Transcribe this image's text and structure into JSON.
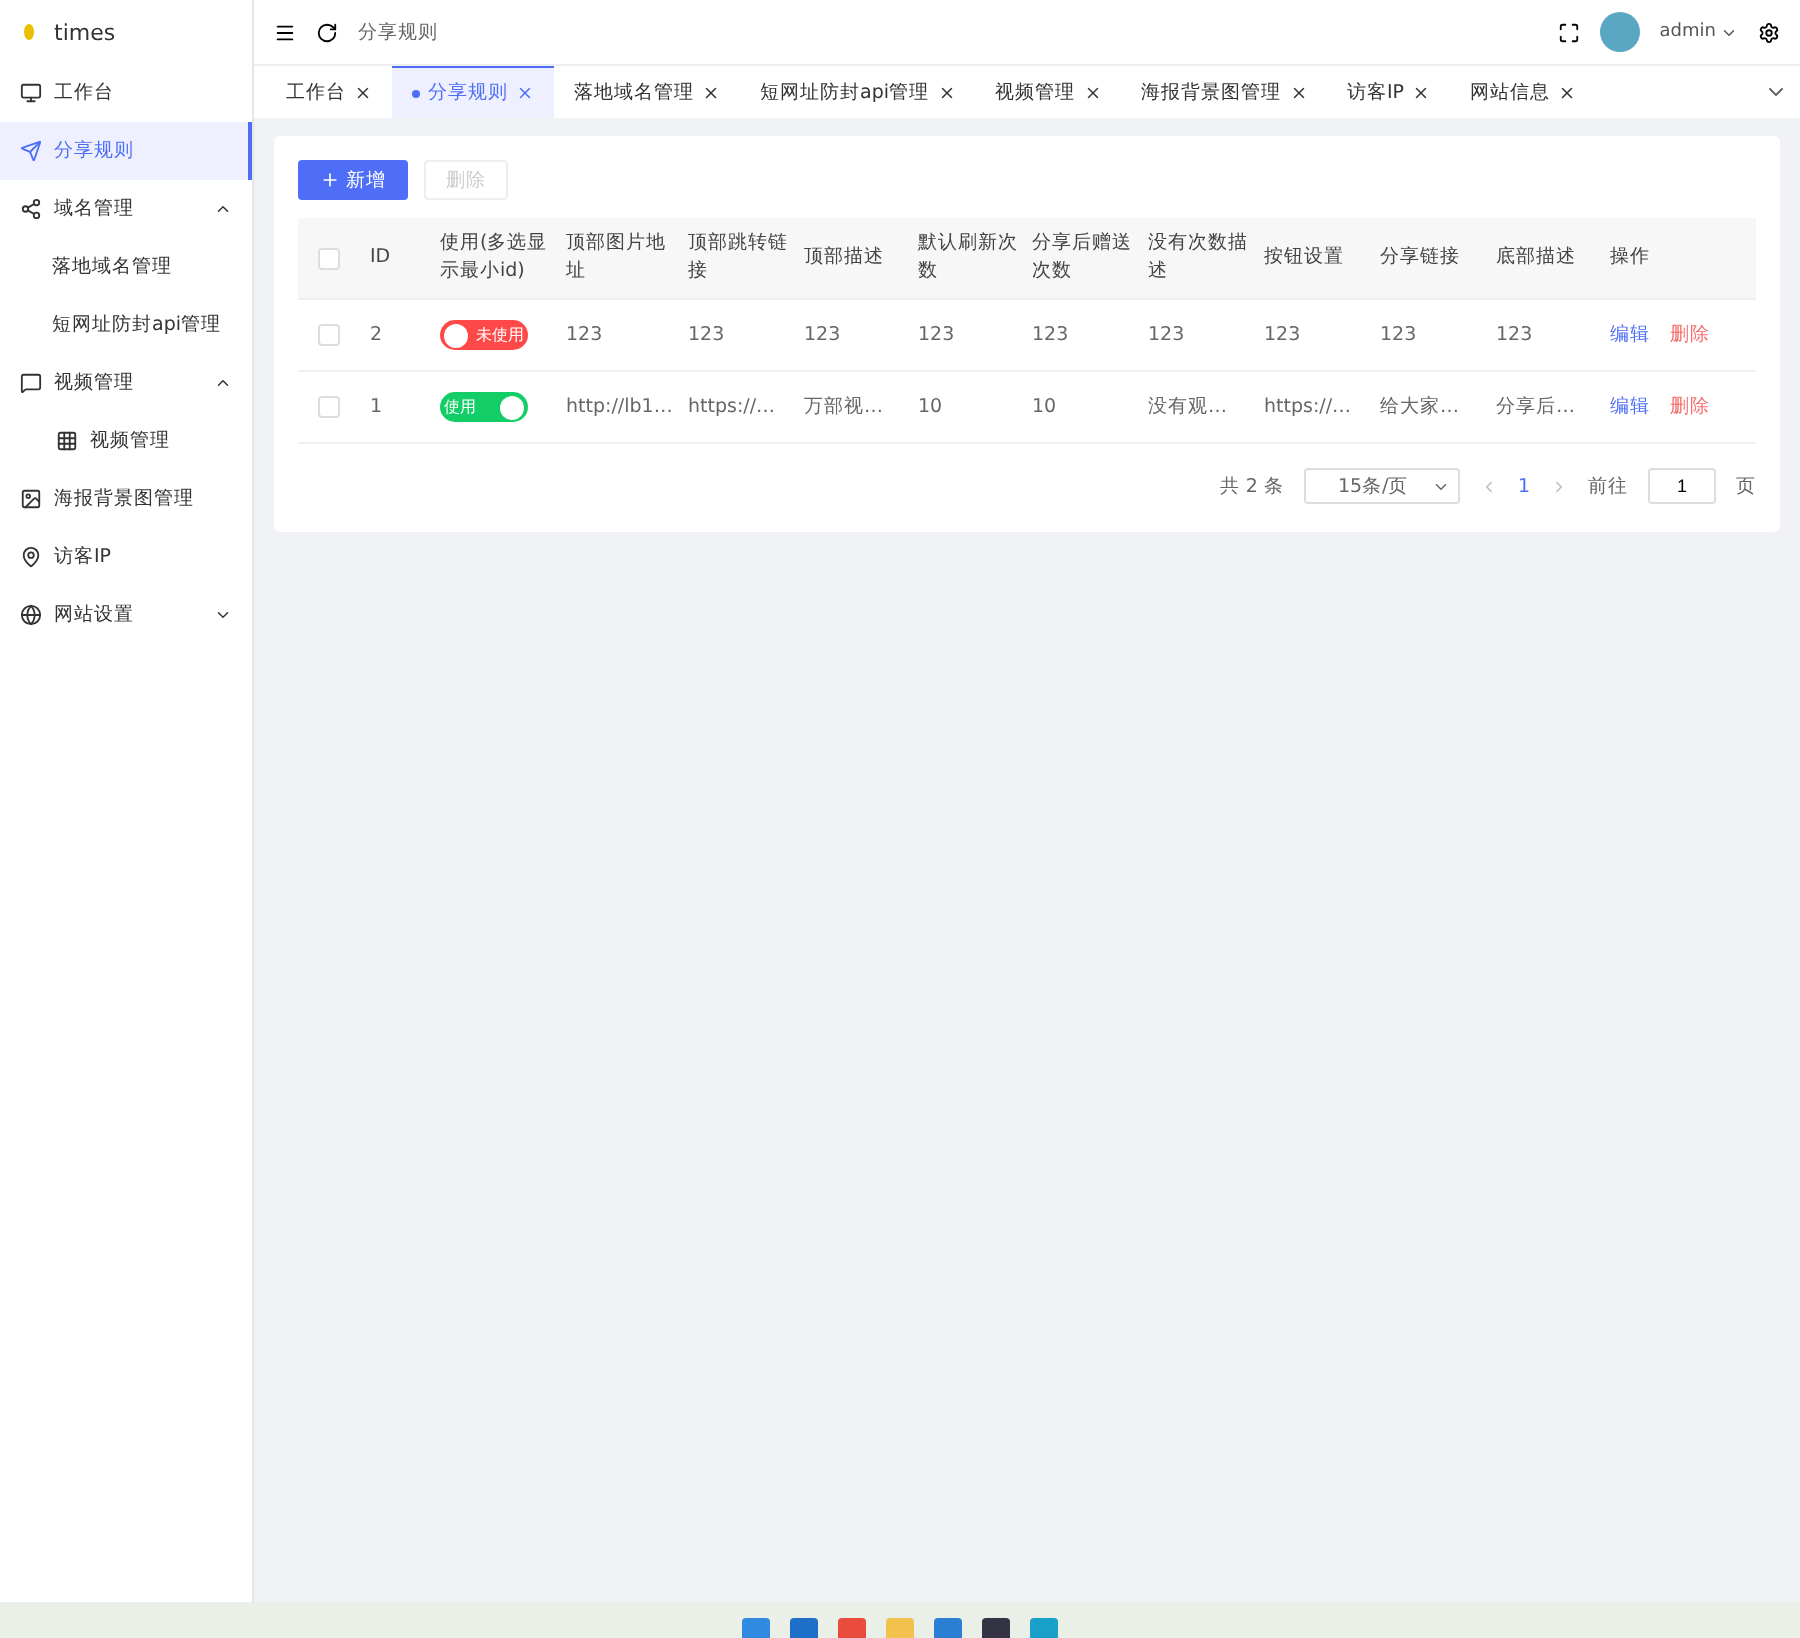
{
  "app": {
    "name": "times"
  },
  "sidebar": {
    "items": [
      {
        "label": "工作台",
        "selected": false
      },
      {
        "label": "分享规则",
        "selected": true
      },
      {
        "label": "域名管理",
        "selected": false,
        "expanded": true,
        "children": [
          {
            "label": "落地域名管理",
            "selected": false
          },
          {
            "label": "短网址防封api管理",
            "selected": false
          }
        ]
      },
      {
        "label": "视频管理",
        "selected": false,
        "expanded": true,
        "children": [
          {
            "label": "视频管理",
            "selected": false
          }
        ]
      },
      {
        "label": "海报背景图管理",
        "selected": false
      },
      {
        "label": "访客IP",
        "selected": false
      },
      {
        "label": "网站设置",
        "selected": false,
        "expanded": false
      }
    ]
  },
  "header": {
    "breadcrumb": "分享规则",
    "user": "admin"
  },
  "tabs": [
    {
      "label": "工作台",
      "selected": false
    },
    {
      "label": "分享规则",
      "selected": true
    },
    {
      "label": "落地域名管理",
      "selected": false
    },
    {
      "label": "短网址防封api管理",
      "selected": false
    },
    {
      "label": "视频管理",
      "selected": false
    },
    {
      "label": "海报背景图管理",
      "selected": false
    },
    {
      "label": "访客IP",
      "selected": false
    },
    {
      "label": "网站信息",
      "selected": false
    }
  ],
  "toolbar": {
    "add": "新增",
    "delete": "删除"
  },
  "table": {
    "select_all_checked": false,
    "columns": [
      "ID",
      "使用(多选显示最小id)",
      "顶部图片地址",
      "顶部跳转链接",
      "顶部描述",
      "默认刷新次数",
      "分享后赠送次数",
      "没有次数描述",
      "按钮设置",
      "分享链接",
      "底部描述",
      "操作"
    ],
    "rows": [
      {
        "checked": false,
        "cells": [
          {
            "kind": "text",
            "text": "2"
          },
          {
            "kind": "switch",
            "on": false,
            "label": "未使用"
          },
          {
            "kind": "text",
            "text": "123"
          },
          {
            "kind": "text",
            "text": "123"
          },
          {
            "kind": "text",
            "text": "123"
          },
          {
            "kind": "text",
            "text": "123"
          },
          {
            "kind": "text",
            "text": "123"
          },
          {
            "kind": "text",
            "text": "123"
          },
          {
            "kind": "text",
            "text": "123"
          },
          {
            "kind": "text",
            "text": "123"
          },
          {
            "kind": "text",
            "text": "123"
          },
          {
            "kind": "actions",
            "actions": [
              "编辑",
              "删除"
            ]
          }
        ]
      },
      {
        "checked": false,
        "cells": [
          {
            "kind": "text",
            "text": "1"
          },
          {
            "kind": "switch",
            "on": true,
            "label": "使用"
          },
          {
            "kind": "text",
            "text": "http://lb1…"
          },
          {
            "kind": "text",
            "text": "https://…"
          },
          {
            "kind": "text",
            "text": "万部视…"
          },
          {
            "kind": "text",
            "text": "10"
          },
          {
            "kind": "text",
            "text": "10"
          },
          {
            "kind": "text",
            "text": "没有观…"
          },
          {
            "kind": "text",
            "text": "https://…"
          },
          {
            "kind": "text",
            "text": "给大家…"
          },
          {
            "kind": "text",
            "text": "分享后…"
          },
          {
            "kind": "actions",
            "actions": [
              "编辑",
              "删除"
            ]
          }
        ]
      }
    ]
  },
  "pagination": {
    "total": "共 2 条",
    "page_size": "15条/页",
    "current": "1",
    "goto_label": "前往",
    "goto_value": "1",
    "goto_suffix": "页"
  }
}
